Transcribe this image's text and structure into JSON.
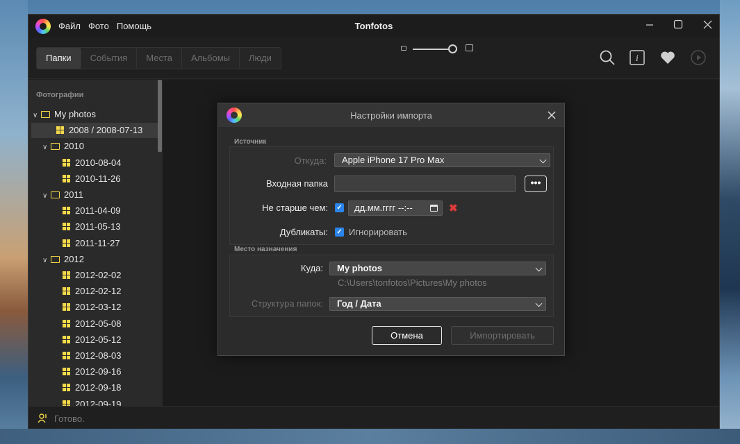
{
  "window": {
    "title": "Tonfotos",
    "menu": [
      "Файл",
      "Фото",
      "Помощь"
    ]
  },
  "toolbar": {
    "tabs": [
      {
        "label": "Папки",
        "active": true
      },
      {
        "label": "События",
        "active": false
      },
      {
        "label": "Места",
        "active": false
      },
      {
        "label": "Альбомы",
        "active": false
      },
      {
        "label": "Люди",
        "active": false
      }
    ],
    "zoom_level": 0.85,
    "icons": [
      "search-icon",
      "info-icon",
      "heart-icon",
      "play-icon"
    ]
  },
  "sidebar": {
    "header": "Фотографии",
    "tree": [
      {
        "label": "My photos",
        "type": "folder",
        "level": 0,
        "expanded": true
      },
      {
        "label": "2008 / 2008-07-13",
        "type": "album",
        "level": 1,
        "selected": true
      },
      {
        "label": "2010",
        "type": "folder",
        "level": 1,
        "expanded": true
      },
      {
        "label": "2010-08-04",
        "type": "album",
        "level": 2
      },
      {
        "label": "2010-11-26",
        "type": "album",
        "level": 2
      },
      {
        "label": "2011",
        "type": "folder",
        "level": 1,
        "expanded": true
      },
      {
        "label": "2011-04-09",
        "type": "album",
        "level": 2
      },
      {
        "label": "2011-05-13",
        "type": "album",
        "level": 2
      },
      {
        "label": "2011-11-27",
        "type": "album",
        "level": 2
      },
      {
        "label": "2012",
        "type": "folder",
        "level": 1,
        "expanded": true
      },
      {
        "label": "2012-02-02",
        "type": "album",
        "level": 2
      },
      {
        "label": "2012-02-12",
        "type": "album",
        "level": 2
      },
      {
        "label": "2012-03-12",
        "type": "album",
        "level": 2
      },
      {
        "label": "2012-05-08",
        "type": "album",
        "level": 2
      },
      {
        "label": "2012-05-12",
        "type": "album",
        "level": 2
      },
      {
        "label": "2012-08-03",
        "type": "album",
        "level": 2
      },
      {
        "label": "2012-09-16",
        "type": "album",
        "level": 2
      },
      {
        "label": "2012-09-18",
        "type": "album",
        "level": 2
      },
      {
        "label": "2012-09-19",
        "type": "album",
        "level": 2
      }
    ]
  },
  "status": {
    "text": "Готово."
  },
  "dialog": {
    "title": "Настройки импорта",
    "source": {
      "group_label": "Источник",
      "from_label": "Откуда:",
      "from_value": "Apple iPhone 17 Pro Max",
      "input_folder_label": "Входная папка",
      "input_folder_value": "",
      "browse_label": "•••",
      "not_older_label": "Не старше чем:",
      "not_older_checked": true,
      "date_placeholder": "дд.мм.гггг  --:--",
      "duplicates_label": "Дубликаты:",
      "duplicates_checked": true,
      "duplicates_option": "Игнорировать"
    },
    "destination": {
      "group_label": "Место назначения",
      "to_label": "Куда:",
      "to_value": "My photos",
      "to_path": "C:\\Users\\tonfotos\\Pictures\\My photos",
      "structure_label": "Структура папок:",
      "structure_value": "Год / Дата"
    },
    "buttons": {
      "cancel": "Отмена",
      "import": "Импортировать"
    }
  },
  "colors": {
    "accent": "#2b84ea",
    "folder": "#f5d94a",
    "clear": "#e23a3a"
  }
}
